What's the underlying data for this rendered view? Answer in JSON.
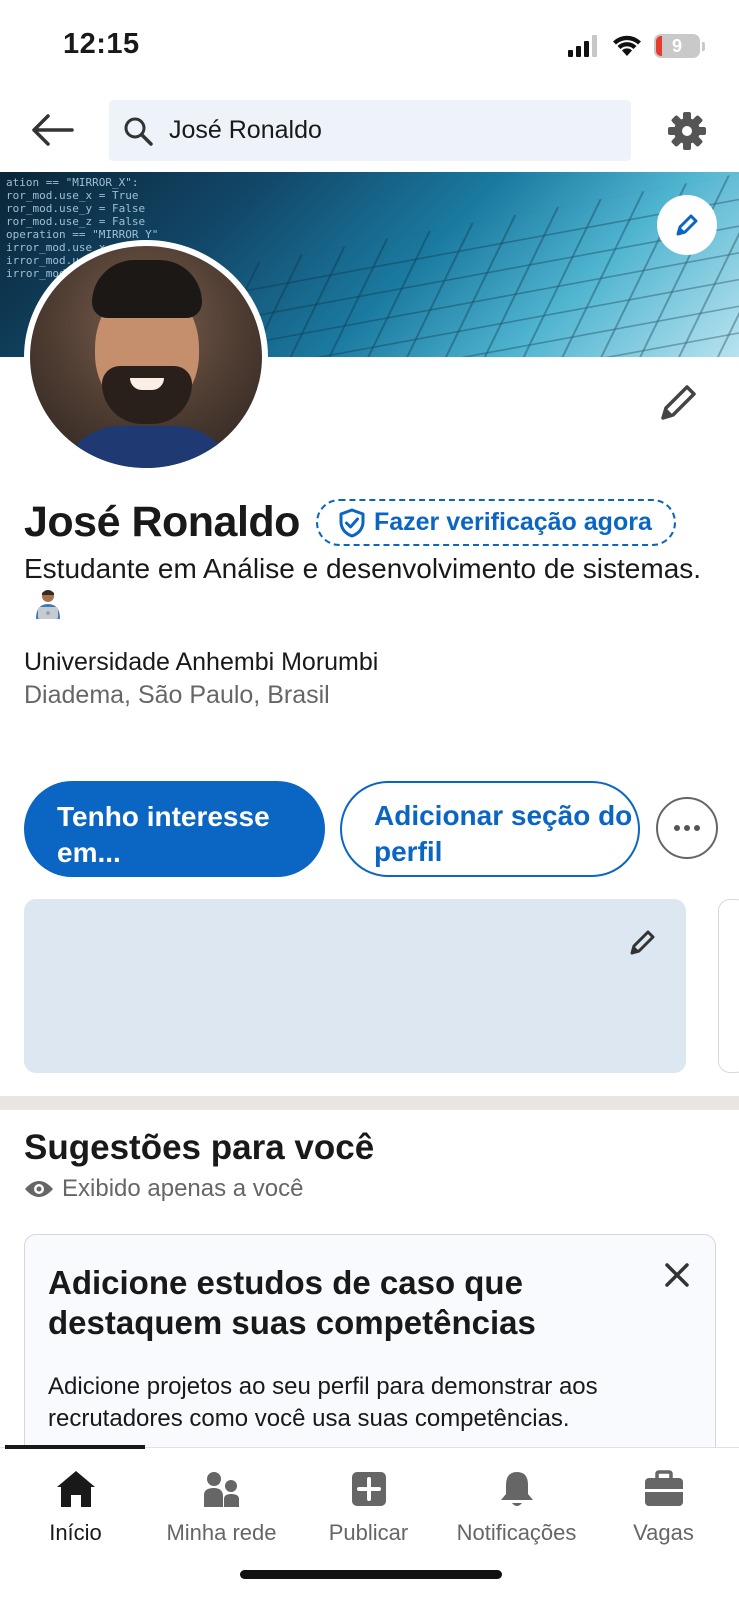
{
  "status_bar": {
    "time": "12:15",
    "battery_level": "9"
  },
  "top_nav": {
    "search_value": "José Ronaldo"
  },
  "banner": {
    "code_text": "ation == \"MIRROR_X\":\nror_mod.use_x = True\nror_mod.use_y = False\nror_mod.use_z = False\noperation == \"MIRROR_Y\"\nirror_mod.use_x = False\nirror_mod.use_y = True\nirror_mod.use_z = False"
  },
  "profile": {
    "name": "José Ronaldo",
    "verify_label": "Fazer verificação agora",
    "headline": "Estudante em Análise e desenvolvimento de sistemas.",
    "school": "Universidade Anhembi Morumbi",
    "location": "Diadema, São Paulo, Brasil"
  },
  "actions": {
    "primary_label": "Tenho interesse em...",
    "secondary_label": "Adicionar seção do perfil"
  },
  "suggestions": {
    "title": "Sugestões para você",
    "visibility": "Exibido apenas a você",
    "card_title": "Adicione estudos de caso que destaquem suas competências",
    "card_body": "Adicione projetos ao seu perfil para demonstrar aos recrutadores como você usa suas competências."
  },
  "bottom_nav": {
    "items": [
      {
        "label": "Início",
        "icon": "home-icon",
        "active": true
      },
      {
        "label": "Minha rede",
        "icon": "people-icon",
        "active": false
      },
      {
        "label": "Publicar",
        "icon": "add-post-icon",
        "active": false
      },
      {
        "label": "Notificações",
        "icon": "bell-icon",
        "active": false
      },
      {
        "label": "Vagas",
        "icon": "briefcase-icon",
        "active": false
      }
    ]
  },
  "colors": {
    "brand_blue": "#0a66c2",
    "text_primary": "#191919",
    "text_secondary": "#666666",
    "search_bg": "#edf3f8",
    "card_blank_bg": "#dde7f1",
    "divider": "#eae6df"
  }
}
